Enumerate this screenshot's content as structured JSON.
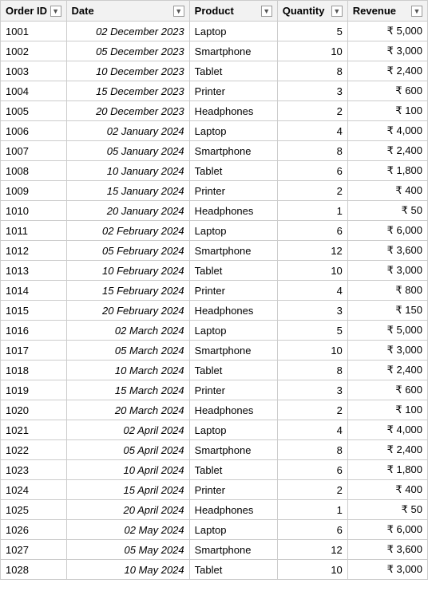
{
  "table": {
    "columns": [
      {
        "id": "orderid",
        "label": "Order ID"
      },
      {
        "id": "date",
        "label": "Date"
      },
      {
        "id": "product",
        "label": "Product"
      },
      {
        "id": "quantity",
        "label": "Quantity"
      },
      {
        "id": "revenue",
        "label": "Revenue"
      }
    ],
    "rows": [
      {
        "orderid": "1001",
        "date": "02 December 2023",
        "product": "Laptop",
        "quantity": "5",
        "revenue": "₹ 5,000"
      },
      {
        "orderid": "1002",
        "date": "05 December 2023",
        "product": "Smartphone",
        "quantity": "10",
        "revenue": "₹ 3,000"
      },
      {
        "orderid": "1003",
        "date": "10 December 2023",
        "product": "Tablet",
        "quantity": "8",
        "revenue": "₹ 2,400"
      },
      {
        "orderid": "1004",
        "date": "15 December 2023",
        "product": "Printer",
        "quantity": "3",
        "revenue": "₹ 600"
      },
      {
        "orderid": "1005",
        "date": "20 December 2023",
        "product": "Headphones",
        "quantity": "2",
        "revenue": "₹ 100"
      },
      {
        "orderid": "1006",
        "date": "02 January 2024",
        "product": "Laptop",
        "quantity": "4",
        "revenue": "₹ 4,000"
      },
      {
        "orderid": "1007",
        "date": "05 January 2024",
        "product": "Smartphone",
        "quantity": "8",
        "revenue": "₹ 2,400"
      },
      {
        "orderid": "1008",
        "date": "10 January 2024",
        "product": "Tablet",
        "quantity": "6",
        "revenue": "₹ 1,800"
      },
      {
        "orderid": "1009",
        "date": "15 January 2024",
        "product": "Printer",
        "quantity": "2",
        "revenue": "₹ 400"
      },
      {
        "orderid": "1010",
        "date": "20 January 2024",
        "product": "Headphones",
        "quantity": "1",
        "revenue": "₹ 50"
      },
      {
        "orderid": "1011",
        "date": "02 February 2024",
        "product": "Laptop",
        "quantity": "6",
        "revenue": "₹ 6,000"
      },
      {
        "orderid": "1012",
        "date": "05 February 2024",
        "product": "Smartphone",
        "quantity": "12",
        "revenue": "₹ 3,600"
      },
      {
        "orderid": "1013",
        "date": "10 February 2024",
        "product": "Tablet",
        "quantity": "10",
        "revenue": "₹ 3,000"
      },
      {
        "orderid": "1014",
        "date": "15 February 2024",
        "product": "Printer",
        "quantity": "4",
        "revenue": "₹ 800"
      },
      {
        "orderid": "1015",
        "date": "20 February 2024",
        "product": "Headphones",
        "quantity": "3",
        "revenue": "₹ 150"
      },
      {
        "orderid": "1016",
        "date": "02 March 2024",
        "product": "Laptop",
        "quantity": "5",
        "revenue": "₹ 5,000"
      },
      {
        "orderid": "1017",
        "date": "05 March 2024",
        "product": "Smartphone",
        "quantity": "10",
        "revenue": "₹ 3,000"
      },
      {
        "orderid": "1018",
        "date": "10 March 2024",
        "product": "Tablet",
        "quantity": "8",
        "revenue": "₹ 2,400"
      },
      {
        "orderid": "1019",
        "date": "15 March 2024",
        "product": "Printer",
        "quantity": "3",
        "revenue": "₹ 600"
      },
      {
        "orderid": "1020",
        "date": "20 March 2024",
        "product": "Headphones",
        "quantity": "2",
        "revenue": "₹ 100"
      },
      {
        "orderid": "1021",
        "date": "02 April 2024",
        "product": "Laptop",
        "quantity": "4",
        "revenue": "₹ 4,000"
      },
      {
        "orderid": "1022",
        "date": "05 April 2024",
        "product": "Smartphone",
        "quantity": "8",
        "revenue": "₹ 2,400"
      },
      {
        "orderid": "1023",
        "date": "10 April 2024",
        "product": "Tablet",
        "quantity": "6",
        "revenue": "₹ 1,800"
      },
      {
        "orderid": "1024",
        "date": "15 April 2024",
        "product": "Printer",
        "quantity": "2",
        "revenue": "₹ 400"
      },
      {
        "orderid": "1025",
        "date": "20 April 2024",
        "product": "Headphones",
        "quantity": "1",
        "revenue": "₹ 50"
      },
      {
        "orderid": "1026",
        "date": "02 May 2024",
        "product": "Laptop",
        "quantity": "6",
        "revenue": "₹ 6,000"
      },
      {
        "orderid": "1027",
        "date": "05 May 2024",
        "product": "Smartphone",
        "quantity": "12",
        "revenue": "₹ 3,600"
      },
      {
        "orderid": "1028",
        "date": "10 May 2024",
        "product": "Tablet",
        "quantity": "10",
        "revenue": "₹ 3,000"
      }
    ]
  }
}
